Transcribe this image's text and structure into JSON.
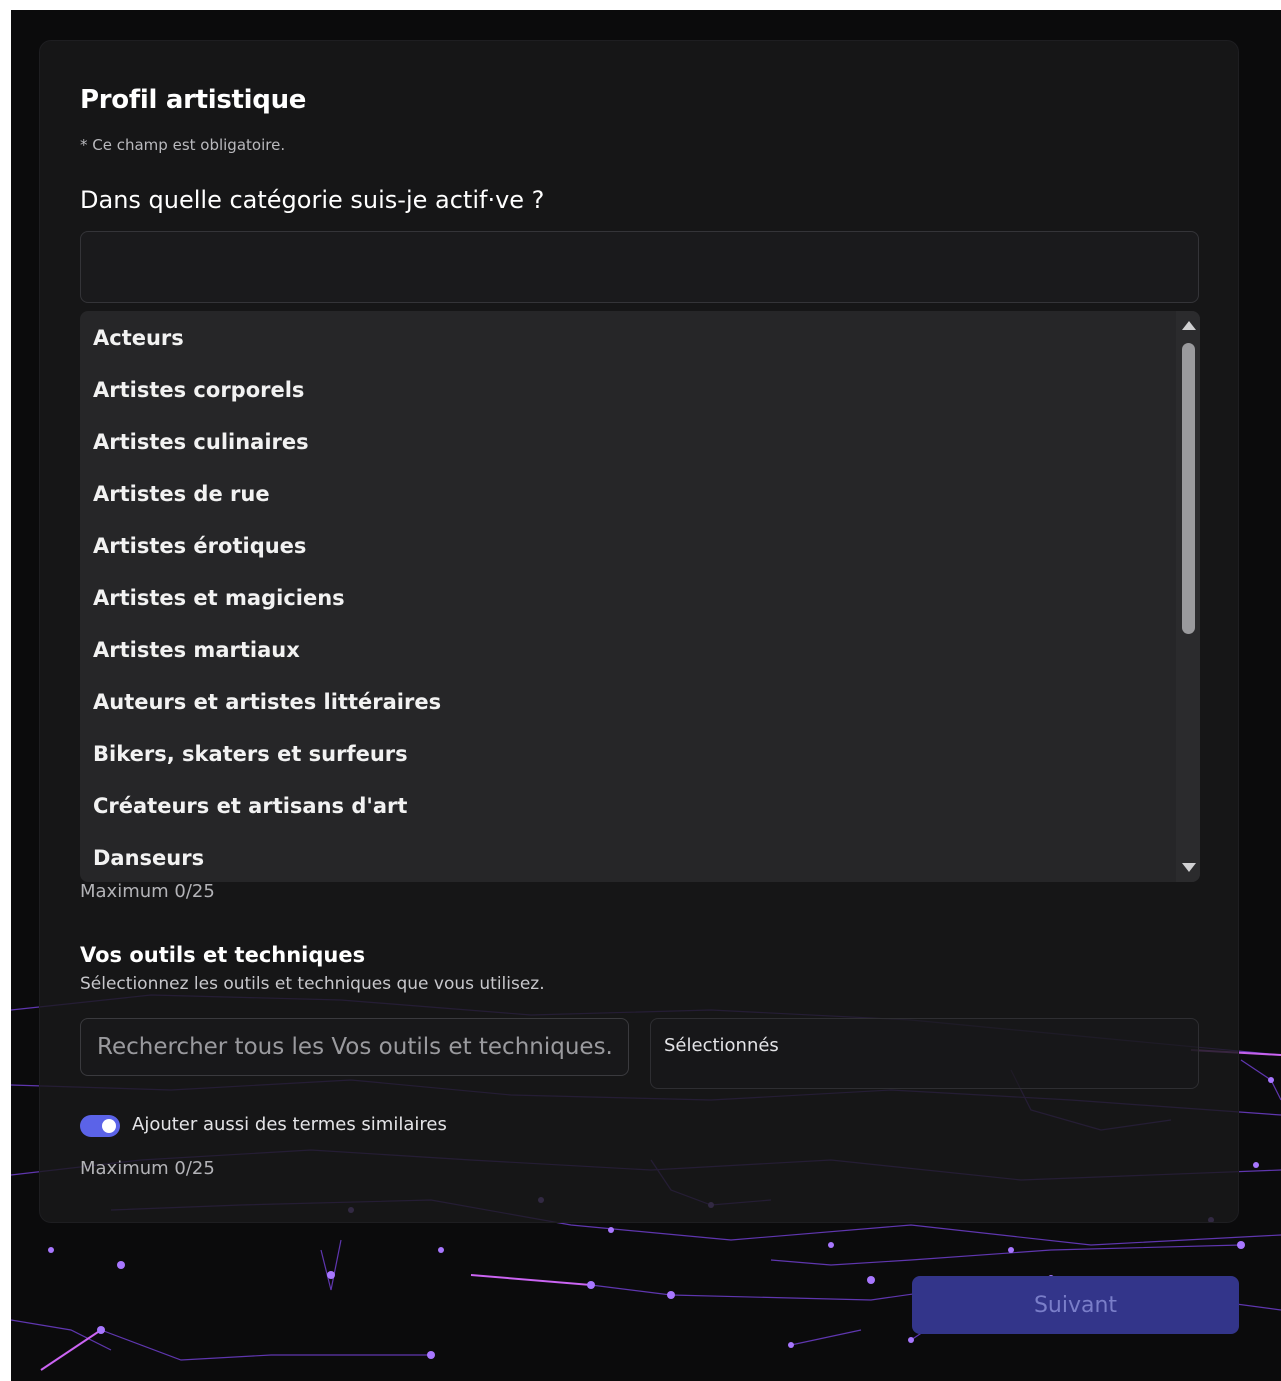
{
  "form": {
    "title": "Profil artistique",
    "required_note": "* Ce champ est obligatoire.",
    "question": "Dans quelle catégorie suis-je actif·ve ?",
    "category_input_value": "",
    "categories": [
      "Acteurs",
      "Artistes corporels",
      "Artistes culinaires",
      "Artistes de rue",
      "Artistes érotiques",
      "Artistes et magiciens",
      "Artistes martiaux",
      "Auteurs et artistes littéraires",
      "Bikers, skaters et surfeurs",
      "Créateurs et artisans d'art",
      "Danseurs"
    ],
    "category_max": "Maximum 0/25"
  },
  "tools": {
    "title": "Vos outils et techniques",
    "description": "Sélectionnez les outils et techniques que vous utilisez.",
    "search_placeholder": "Rechercher tous les Vos outils et techniques..",
    "selected_label": "Sélectionnés",
    "toggle_label": "Ajouter aussi des termes similaires",
    "toggle_on": true,
    "max": "Maximum 0/25"
  },
  "actions": {
    "next_label": "Suivant"
  },
  "colors": {
    "accent": "#5b63e8",
    "button_bg": "#33358a",
    "network_line": "#8a4dff"
  }
}
